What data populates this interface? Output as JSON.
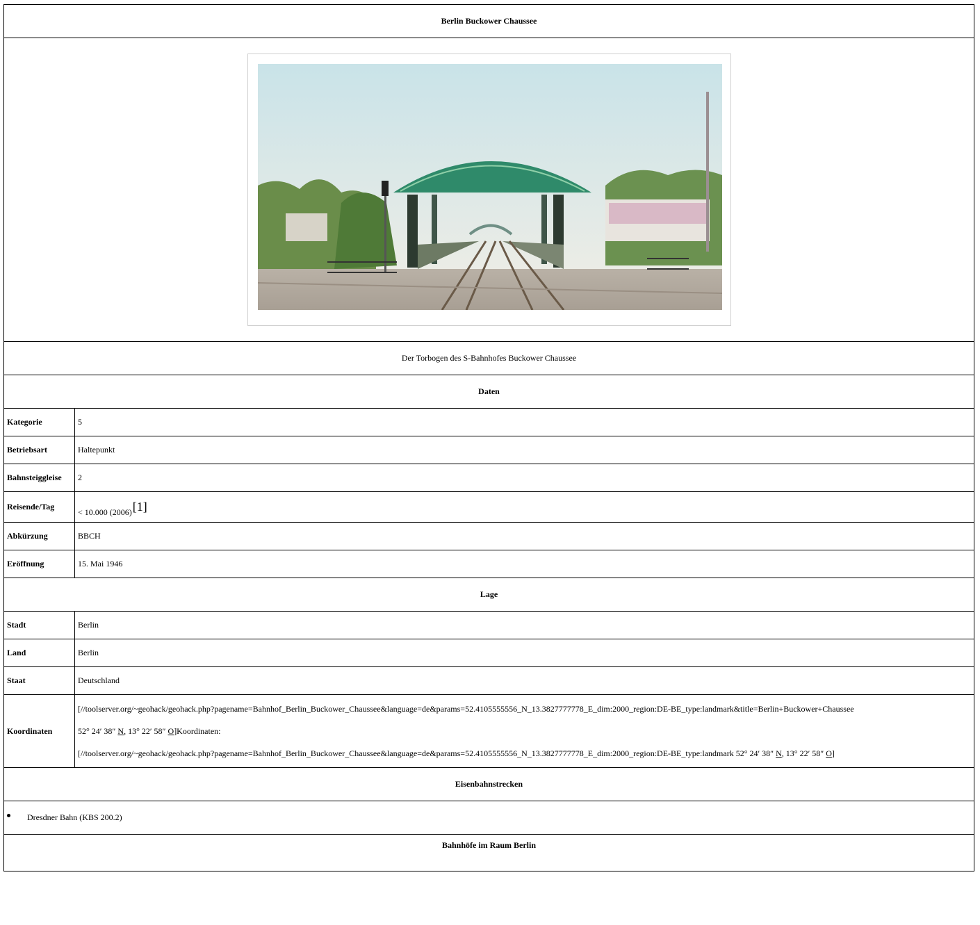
{
  "infobox": {
    "title": "Berlin Buckower Chaussee",
    "image": {
      "icon": "station-photo-image",
      "caption": "Der Torbogen des S-Bahnhofes Buckower Chaussee"
    },
    "sections": {
      "daten": "Daten",
      "lage": "Lage",
      "strecken": "Eisenbahnstrecken",
      "bahnhoefe": "Bahnhöfe im Raum Berlin"
    },
    "daten_rows": [
      {
        "label": "Kategorie",
        "value": "5"
      },
      {
        "label": "Betriebsart",
        "value": "Haltepunkt"
      },
      {
        "label": "Bahnsteiggleise",
        "value": "2"
      },
      {
        "label": "Reisende/Tag",
        "value": "< 10.000 (2006)",
        "ref": "[1]"
      },
      {
        "label": "Abkürzung",
        "value": "BBCH"
      },
      {
        "label": "Eröffnung",
        "value": "15. Mai 1946"
      }
    ],
    "lage_rows": [
      {
        "label": "Stadt",
        "value": "Berlin"
      },
      {
        "label": "Land",
        "value": "Berlin"
      },
      {
        "label": "Staat",
        "value": "Deutschland"
      }
    ],
    "koordinaten": {
      "label": "Koordinaten",
      "line1": "[//toolserver.org/~geohack/geohack.php?pagename=Bahnhof_Berlin_Buckower_Chaussee&language=de&params=52.4105555556_N_13.3827777778_E_dim:2000_region:DE-BE_type:landmark&title=Berlin+Buckower+Chaussee",
      "line2_pre": "52° 24′ 38″ ",
      "line2_n": "N",
      "line2_mid": ", 13° 22′ 58″ ",
      "line2_o": "O",
      "line2_post": "]Koordinaten:",
      "line3_pre": "[//toolserver.org/~geohack/geohack.php?pagename=Bahnhof_Berlin_Buckower_Chaussee&language=de&params=52.4105555556_N_13.3827777778_E_dim:2000_region:DE-BE_type:landmark 52° 24′ 38″ ",
      "line3_n": "N",
      "line3_mid": ", 13° 22′ 58″ ",
      "line3_o": "O",
      "line3_post": "]"
    },
    "strecken_items": [
      "Dresdner Bahn (KBS 200.2)"
    ]
  }
}
